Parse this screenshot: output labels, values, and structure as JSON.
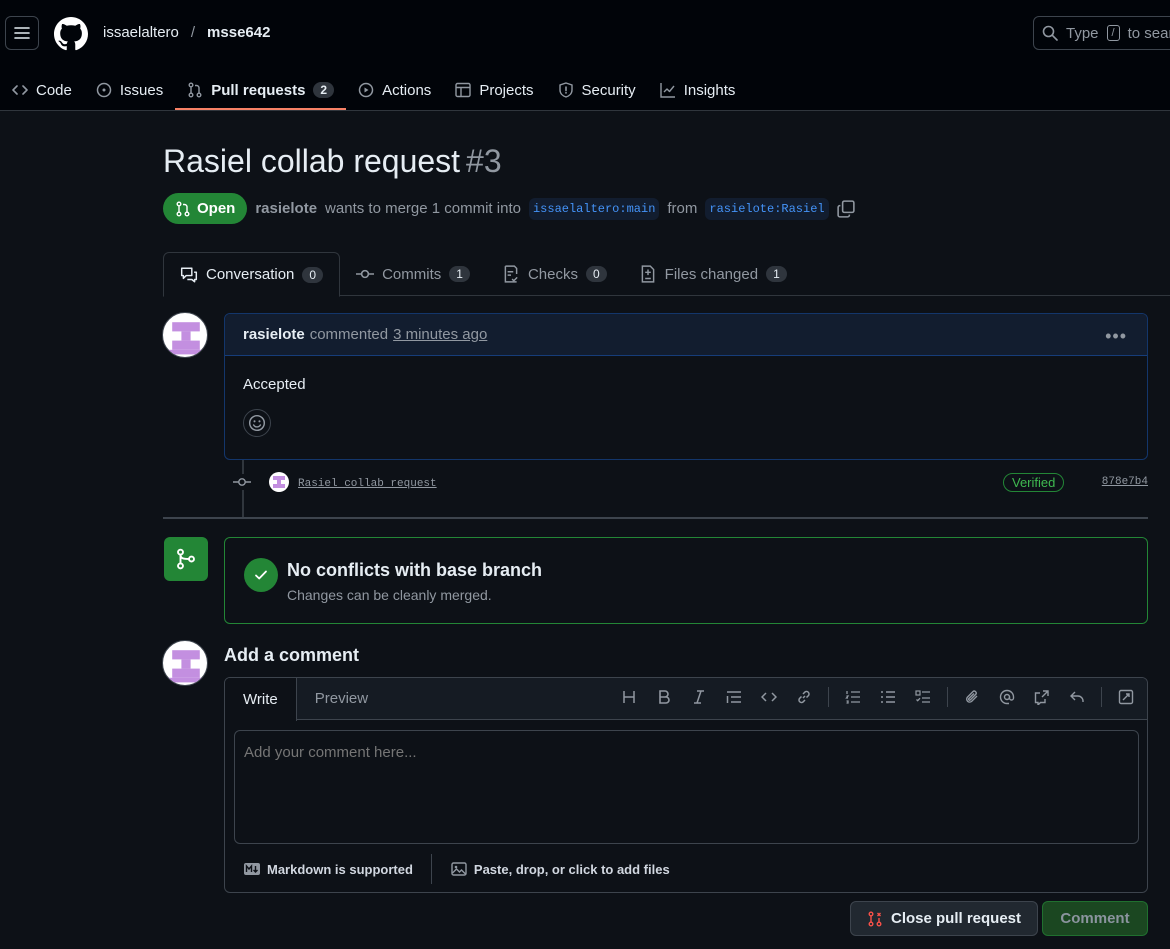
{
  "header": {
    "owner": "issaelaltero",
    "separator": "/",
    "repo": "msse642",
    "search_placeholder": "Type",
    "search_key": "/",
    "search_suffix": "to search"
  },
  "nav": {
    "tabs": [
      {
        "label": "Code",
        "icon": "code-icon"
      },
      {
        "label": "Issues",
        "icon": "issue-icon"
      },
      {
        "label": "Pull requests",
        "icon": "pull-request-icon",
        "count": "2",
        "active": true
      },
      {
        "label": "Actions",
        "icon": "play-icon"
      },
      {
        "label": "Projects",
        "icon": "table-icon"
      },
      {
        "label": "Security",
        "icon": "shield-icon"
      },
      {
        "label": "Insights",
        "icon": "graph-icon"
      }
    ]
  },
  "pr": {
    "title": "Rasiel collab request",
    "number": "#3",
    "state": "Open",
    "author": "rasielote",
    "merge_text": "wants to merge 1 commit into",
    "base": "issaelaltero:main",
    "from_text": "from",
    "head": "rasielote:Rasiel"
  },
  "pr_tabs": [
    {
      "label": "Conversation",
      "count": "0",
      "icon": "comment-icon"
    },
    {
      "label": "Commits",
      "count": "1",
      "icon": "commit-icon"
    },
    {
      "label": "Checks",
      "count": "0",
      "icon": "checklist-icon"
    },
    {
      "label": "Files changed",
      "count": "1",
      "icon": "diff-icon"
    }
  ],
  "comment": {
    "author": "rasielote",
    "action": "commented",
    "time": "3 minutes ago",
    "body": "Accepted"
  },
  "commit": {
    "message": "Rasiel collab request",
    "verified": "Verified",
    "sha": "878e7b4"
  },
  "merge": {
    "title": "No conflicts with base branch",
    "subtitle": "Changes can be cleanly merged."
  },
  "add_comment": {
    "title": "Add a comment",
    "tab_write": "Write",
    "tab_preview": "Preview",
    "placeholder": "Add your comment here...",
    "markdown": "Markdown is supported",
    "attach": "Paste, drop, or click to add files"
  },
  "buttons": {
    "close": "Close pull request",
    "comment": "Comment"
  },
  "colors": {
    "bg": "#0d1117",
    "header_bg": "#010409",
    "green": "#238636",
    "accent_blue": "#4493f8",
    "tab_underline": "#f78166",
    "close_icon": "#f85149"
  }
}
